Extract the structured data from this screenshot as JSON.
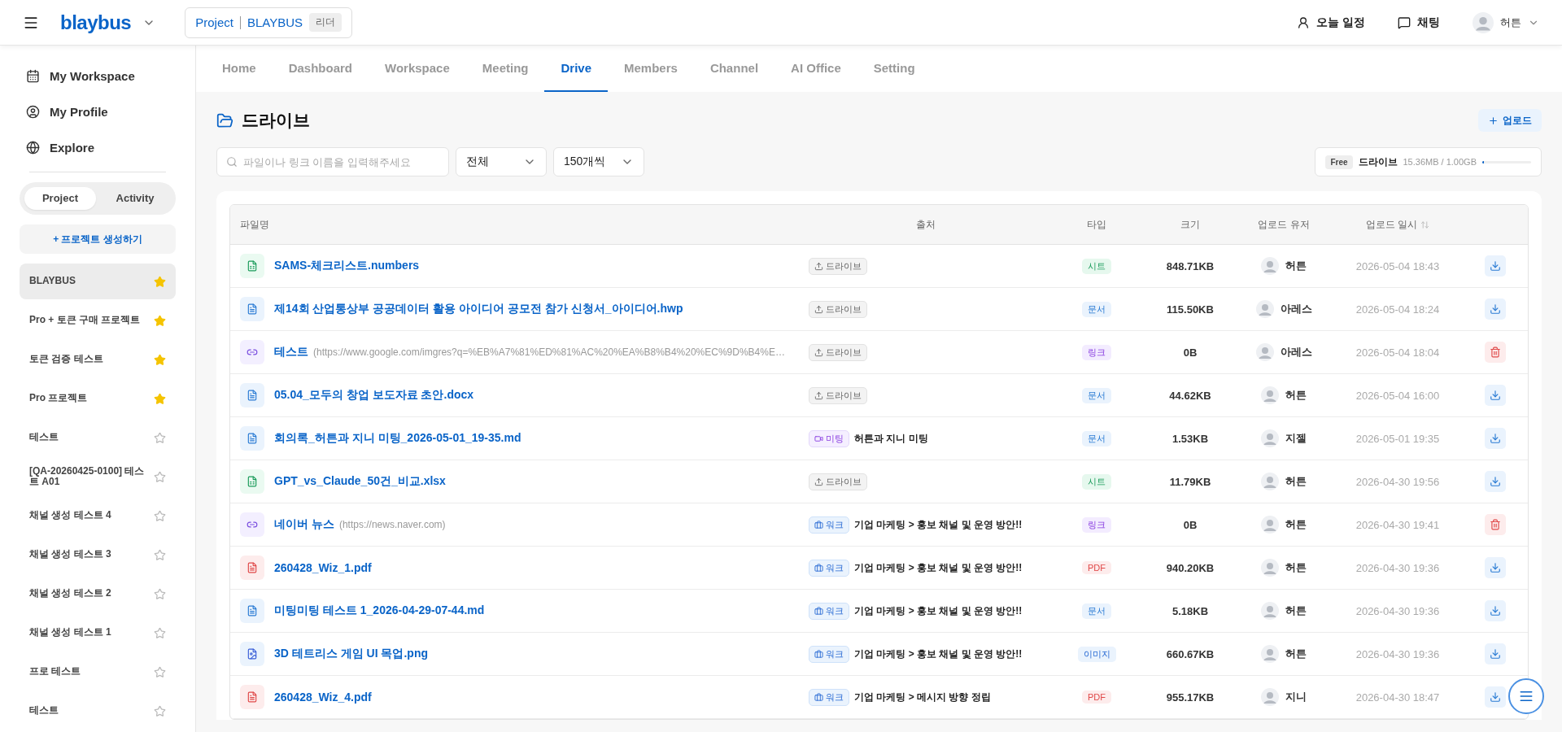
{
  "header": {
    "logo": "blaybus",
    "project_label": "Project",
    "project_name": "BLAYBUS",
    "role": "리더",
    "schedule": "오늘 일정",
    "chat": "채팅",
    "user": "허튼"
  },
  "sidebar": {
    "nav": [
      {
        "kind": "calendar",
        "label": "My Workspace"
      },
      {
        "kind": "profile",
        "label": "My Profile"
      },
      {
        "kind": "explore",
        "label": "Explore"
      }
    ],
    "segments": [
      {
        "label": "Project",
        "selected": true
      },
      {
        "label": "Activity",
        "selected": false
      }
    ],
    "create_button": "+ 프로젝트 생성하기",
    "projects": [
      {
        "name": "BLAYBUS",
        "starred": true,
        "selected": true
      },
      {
        "name": "Pro + 토큰 구매 프로젝트",
        "starred": true,
        "selected": false
      },
      {
        "name": "토큰 검증 테스트",
        "starred": true,
        "selected": false
      },
      {
        "name": "Pro 프로젝트",
        "starred": true,
        "selected": false
      },
      {
        "name": "테스트",
        "starred": false,
        "selected": false
      },
      {
        "name": "[QA-20260425-0100] 테스트 A01",
        "starred": false,
        "selected": false
      },
      {
        "name": "채널 생성 테스트 4",
        "starred": false,
        "selected": false
      },
      {
        "name": "채널 생성 테스트 3",
        "starred": false,
        "selected": false
      },
      {
        "name": "채널 생성 테스트 2",
        "starred": false,
        "selected": false
      },
      {
        "name": "채널 생성 테스트 1",
        "starred": false,
        "selected": false
      },
      {
        "name": "프로 테스트",
        "starred": false,
        "selected": false
      },
      {
        "name": "테스트",
        "starred": false,
        "selected": false
      }
    ]
  },
  "tabs": [
    {
      "label": "Home",
      "selected": false
    },
    {
      "label": "Dashboard",
      "selected": false
    },
    {
      "label": "Workspace",
      "selected": false
    },
    {
      "label": "Meeting",
      "selected": false
    },
    {
      "label": "Drive",
      "selected": true
    },
    {
      "label": "Members",
      "selected": false
    },
    {
      "label": "Channel",
      "selected": false
    },
    {
      "label": "AI Office",
      "selected": false
    },
    {
      "label": "Setting",
      "selected": false
    }
  ],
  "page": {
    "title": "드라이브",
    "upload_button": "업로드",
    "search": {
      "placeholder": "파일이나 링크 이름을 입력해주세요"
    },
    "filter": "전체",
    "page_size": "150개씩",
    "storage": {
      "plan": "Free",
      "label": "드라이브",
      "usage": "15.36MB / 1.00GB",
      "level": 0.015
    }
  },
  "table": {
    "columns": [
      "파일명",
      "출처",
      "타입",
      "크기",
      "업로드 유저",
      "업로드 일시"
    ],
    "rows": [
      {
        "kind": "sheet",
        "name": "SAMS-체크리스트.numbers",
        "source": {
          "kind": "drive",
          "tag": "드라이브"
        },
        "type": {
          "kind": "sheet",
          "label": "시트"
        },
        "size": "848.71KB",
        "user": "허튼",
        "date": "2026-05-04 18:43",
        "action": {
          "kind": "download"
        }
      },
      {
        "kind": "doc",
        "name": "제14회 산업통상부 공공데이터 활용 아이디어 공모전 참가 신청서_아이디어.hwp",
        "source": {
          "kind": "drive",
          "tag": "드라이브"
        },
        "type": {
          "kind": "doc",
          "label": "문서"
        },
        "size": "115.50KB",
        "user": "아레스",
        "date": "2026-05-04 18:24",
        "action": {
          "kind": "download"
        }
      },
      {
        "kind": "link",
        "name": "테스트",
        "url": "(https://www.google.com/imgres?q=%EB%A7%81%ED%81%AC%20%EA%B8%B4%20%EC%9D%B4%E…",
        "source": {
          "kind": "drive",
          "tag": "드라이브"
        },
        "type": {
          "kind": "link",
          "label": "링크"
        },
        "size": "0B",
        "user": "아레스",
        "date": "2026-05-04 18:04",
        "action": {
          "kind": "delete"
        }
      },
      {
        "kind": "doc",
        "name": "05.04_모두의 창업 보도자료 초안.docx",
        "source": {
          "kind": "drive",
          "tag": "드라이브"
        },
        "type": {
          "kind": "doc",
          "label": "문서"
        },
        "size": "44.62KB",
        "user": "허튼",
        "date": "2026-05-04 16:00",
        "action": {
          "kind": "download"
        }
      },
      {
        "kind": "doc",
        "name": "회의록_허튼과 지니 미팅_2026-05-01_19-35.md",
        "source": {
          "kind": "meeting",
          "tag": "미팅",
          "text": "허튼과 지니 미팅"
        },
        "type": {
          "kind": "doc",
          "label": "문서"
        },
        "size": "1.53KB",
        "user": "지젤",
        "date": "2026-05-01 19:35",
        "action": {
          "kind": "download"
        }
      },
      {
        "kind": "sheet",
        "name": "GPT_vs_Claude_50건_비교.xlsx",
        "source": {
          "kind": "drive",
          "tag": "드라이브"
        },
        "type": {
          "kind": "sheet",
          "label": "시트"
        },
        "size": "11.79KB",
        "user": "허튼",
        "date": "2026-04-30 19:56",
        "action": {
          "kind": "download"
        }
      },
      {
        "kind": "link",
        "name": "네이버 뉴스",
        "url": "(https://news.naver.com)",
        "source": {
          "kind": "work",
          "tag": "워크",
          "text": "기업 마케팅 > 홍보 채널 및 운영 방안!!"
        },
        "type": {
          "kind": "link",
          "label": "링크"
        },
        "size": "0B",
        "user": "허튼",
        "date": "2026-04-30 19:41",
        "action": {
          "kind": "delete"
        }
      },
      {
        "kind": "pdf",
        "name": "260428_Wiz_1.pdf",
        "source": {
          "kind": "work",
          "tag": "워크",
          "text": "기업 마케팅 > 홍보 채널 및 운영 방안!!"
        },
        "type": {
          "kind": "pdf",
          "label": "PDF"
        },
        "size": "940.20KB",
        "user": "허튼",
        "date": "2026-04-30 19:36",
        "action": {
          "kind": "download"
        }
      },
      {
        "kind": "doc",
        "name": "미팅미팅 테스트 1_2026-04-29-07-44.md",
        "source": {
          "kind": "work",
          "tag": "워크",
          "text": "기업 마케팅 > 홍보 채널 및 운영 방안!!"
        },
        "type": {
          "kind": "doc",
          "label": "문서"
        },
        "size": "5.18KB",
        "user": "허튼",
        "date": "2026-04-30 19:36",
        "action": {
          "kind": "download"
        }
      },
      {
        "kind": "image",
        "name": "3D 테트리스 게임 UI 목업.png",
        "source": {
          "kind": "work",
          "tag": "워크",
          "text": "기업 마케팅 > 홍보 채널 및 운영 방안!!"
        },
        "type": {
          "kind": "image",
          "label": "이미지"
        },
        "size": "660.67KB",
        "user": "허튼",
        "date": "2026-04-30 19:36",
        "action": {
          "kind": "download"
        }
      },
      {
        "kind": "pdf",
        "name": "260428_Wiz_4.pdf",
        "source": {
          "kind": "work",
          "tag": "워크",
          "text": "기업 마케팅 > 메시지 방향 정립"
        },
        "type": {
          "kind": "pdf",
          "label": "PDF"
        },
        "size": "955.17KB",
        "user": "지니",
        "date": "2026-04-30 18:47",
        "action": {
          "kind": "download"
        }
      }
    ]
  }
}
